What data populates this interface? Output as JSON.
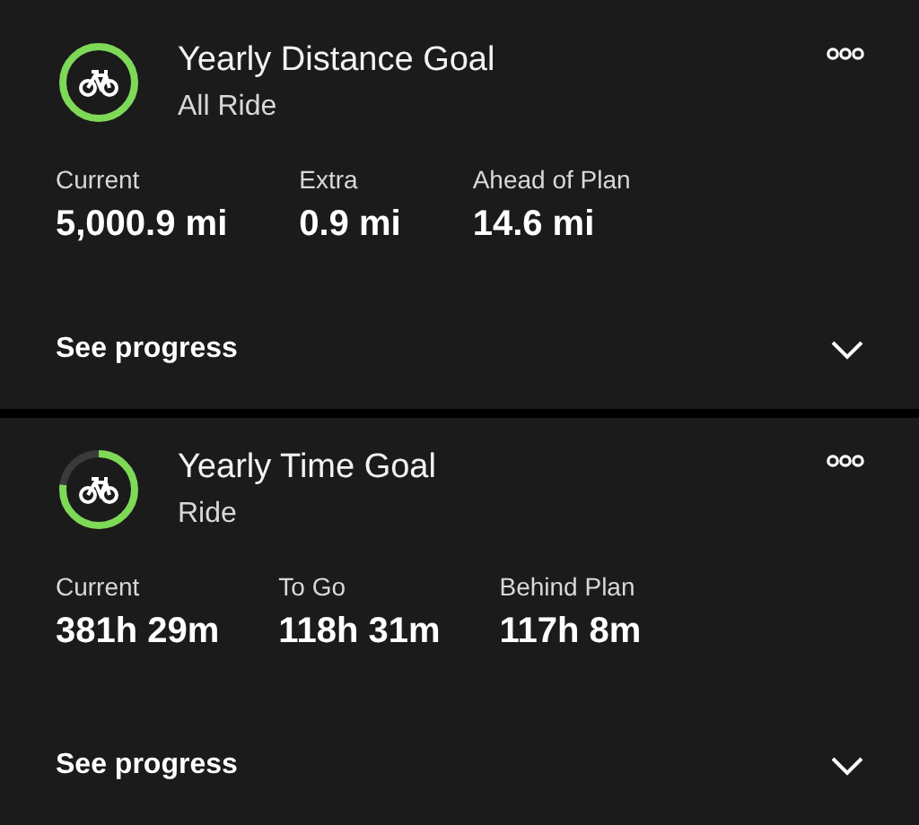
{
  "goals": [
    {
      "title": "Yearly Distance Goal",
      "subtitle": "All Ride",
      "stats": [
        {
          "label": "Current",
          "value": "5,000.9 mi"
        },
        {
          "label": "Extra",
          "value": "0.9 mi"
        },
        {
          "label": "Ahead of Plan",
          "value": "14.6 mi"
        }
      ],
      "link": "See progress",
      "expanded": false
    },
    {
      "title": "Yearly Time Goal",
      "subtitle": "Ride",
      "stats": [
        {
          "label": "Current",
          "value": "381h 29m"
        },
        {
          "label": "To Go",
          "value": "118h 31m"
        },
        {
          "label": "Behind Plan",
          "value": "117h 8m"
        }
      ],
      "link": "See progress",
      "expanded": false
    }
  ]
}
